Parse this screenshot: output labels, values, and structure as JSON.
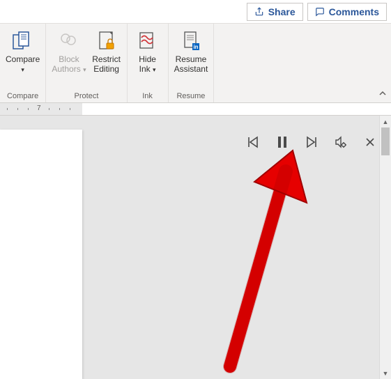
{
  "topbar": {
    "share": "Share",
    "comments": "Comments"
  },
  "ribbon": {
    "compare": {
      "label": "Compare",
      "group": "Compare"
    },
    "block_authors": {
      "label1": "Block",
      "label2": "Authors"
    },
    "restrict_editing": {
      "label1": "Restrict",
      "label2": "Editing"
    },
    "protect_group": "Protect",
    "hide_ink": {
      "label1": "Hide",
      "label2": "Ink"
    },
    "ink_group": "Ink",
    "resume_assistant": {
      "label1": "Resume",
      "label2": "Assistant"
    },
    "resume_group": "Resume"
  },
  "ruler": {
    "mark": "7"
  }
}
